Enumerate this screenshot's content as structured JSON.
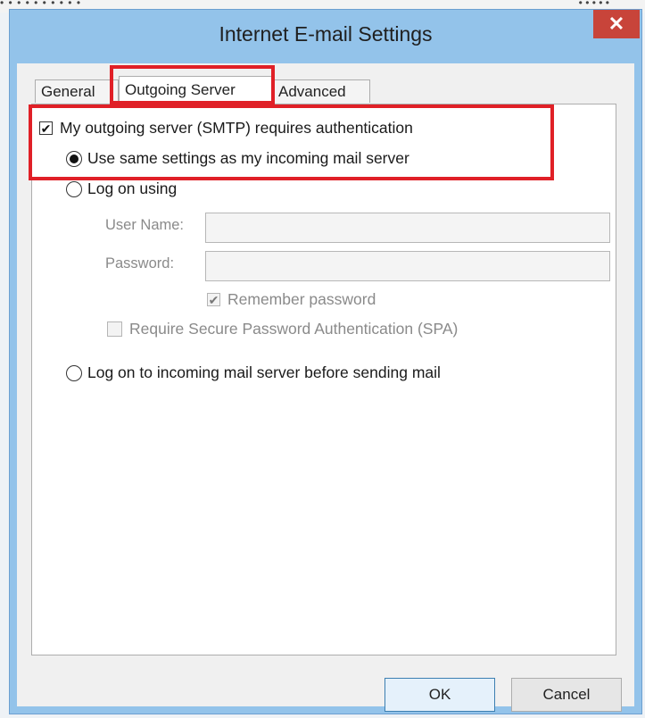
{
  "background": {
    "left_text": "• • • • • • • • • •",
    "right_text": "• • • • •"
  },
  "window": {
    "title": "Internet E-mail Settings",
    "close_glyph": "✕"
  },
  "tabs": [
    {
      "label": "General",
      "active": false
    },
    {
      "label": "Outgoing Server",
      "active": true
    },
    {
      "label": "Advanced",
      "active": false
    }
  ],
  "smtp_auth": {
    "label": "My outgoing server (SMTP) requires authentication",
    "checked": true
  },
  "same_settings": {
    "label": "Use same settings as my incoming mail server",
    "selected": true
  },
  "log_on_using": {
    "label": "Log on using",
    "selected": false
  },
  "user_name": {
    "label": "User Name:",
    "value": ""
  },
  "password": {
    "label": "Password:",
    "value": ""
  },
  "remember_password": {
    "label": "Remember password",
    "checked": true,
    "enabled": false
  },
  "require_spa": {
    "label": "Require Secure Password Authentication (SPA)",
    "checked": false,
    "enabled": false
  },
  "log_on_incoming": {
    "label": "Log on to incoming mail server before sending mail",
    "selected": false
  },
  "buttons": {
    "ok": "OK",
    "cancel": "Cancel"
  },
  "colors": {
    "highlight": "#e02027",
    "title_bar": "#93c3ea",
    "close": "#c8443a"
  },
  "icons": {
    "check": "✔",
    "close": "close-icon"
  }
}
